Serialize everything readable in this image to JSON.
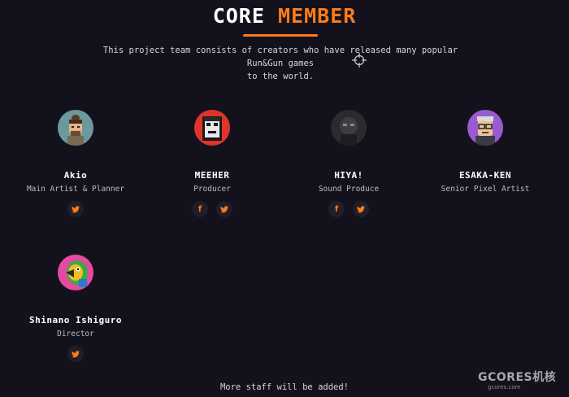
{
  "header": {
    "title_part1": "CORE",
    "title_part2": "MEMBER",
    "accent_color": "#ff7a1a",
    "description_line1": "This project team consists of creators who have released many popular Run&Gun games",
    "description_line2": "to the world."
  },
  "members": [
    {
      "name": "Akio",
      "role": "Main Artist & Planner",
      "socials": [
        "twitter-icon"
      ],
      "avatar_color": "#6a9a9e"
    },
    {
      "name": "MEEHER",
      "role": "Producer",
      "socials": [
        "facebook-icon",
        "twitter-icon"
      ],
      "avatar_color": "#e0342b"
    },
    {
      "name": "HIYA!",
      "role": "Sound Produce",
      "socials": [
        "facebook-icon",
        "twitter-icon"
      ],
      "avatar_color": "#2b2b2e"
    },
    {
      "name": "ESAKA-KEN",
      "role": "Senior Pixel Artist",
      "socials": [
        "twitter-icon"
      ],
      "avatar_color": "#9b5bd0"
    },
    {
      "name": "Shinano Ishiguro",
      "role": "Director",
      "socials": [
        "twitter-icon"
      ],
      "avatar_color": "#e64aa0"
    }
  ],
  "social_labels": {
    "facebook": "f"
  },
  "footer": {
    "text": "More staff will be added!"
  },
  "watermark": {
    "main": "GCORES机核",
    "sub": "gcores.com"
  }
}
